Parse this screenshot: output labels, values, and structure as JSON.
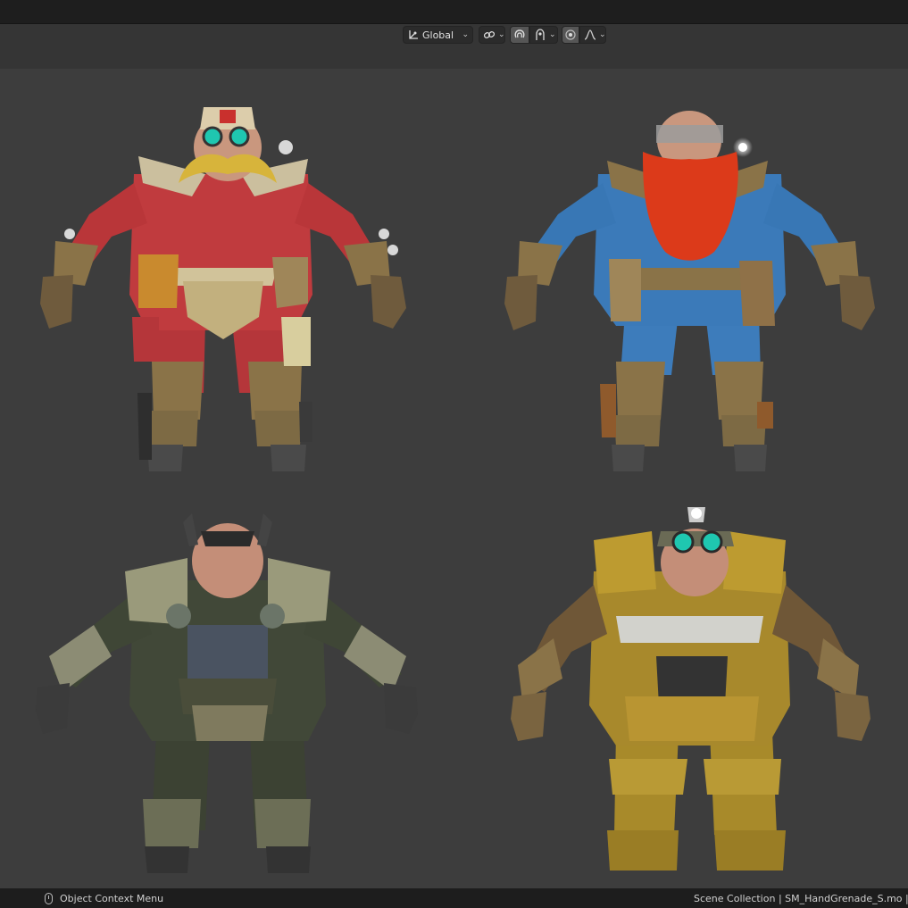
{
  "header": {
    "transform_orientation": "Global",
    "icons": [
      "transform-pivot-icon",
      "snap-link-icon",
      "snap-magnet-icon",
      "snap-target-icon",
      "proportional-edit-icon",
      "falloff-curve-icon"
    ]
  },
  "viewport": {
    "characters": [
      {
        "name": "dwarf-red-medic",
        "outfit_color": "#b9393a"
      },
      {
        "name": "dwarf-blue-redbeard",
        "outfit_color": "#3b79b8"
      },
      {
        "name": "dwarf-green-camo",
        "outfit_color": "#3f4636"
      },
      {
        "name": "dwarf-gold-armor",
        "outfit_color": "#a8892c"
      }
    ]
  },
  "statusbar": {
    "left_label": "Object Context Menu",
    "right_text": "Scene Collection | SM_HandGrenade_S.mo | Verti"
  },
  "colors": {
    "background": "#3d3d3d",
    "header": "#353535",
    "statusbar": "#1d1d1d",
    "accent_goggles": "#1fc7b0"
  }
}
